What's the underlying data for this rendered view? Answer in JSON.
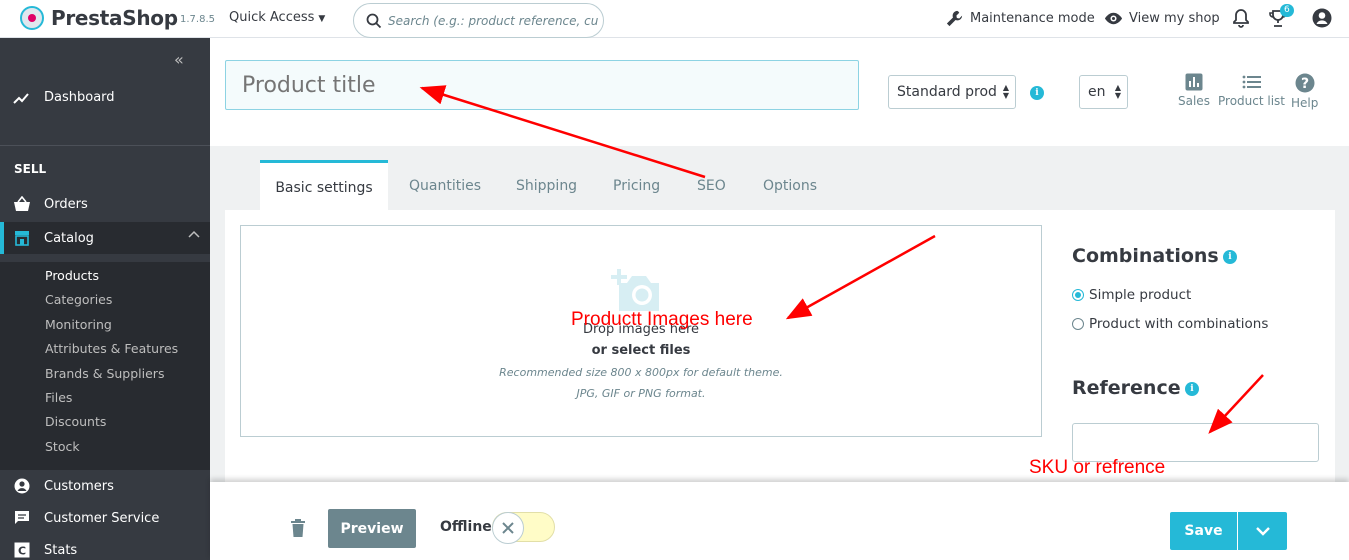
{
  "header": {
    "brand_prefix": "Presta",
    "brand_suffix": "Shop",
    "version": "1.7.8.5",
    "quick_access": "Quick Access",
    "search_placeholder": "Search (e.g.: product reference, custon",
    "maintenance": "Maintenance mode",
    "view_shop": "View my shop",
    "trophy_badge": "6"
  },
  "sidebar": {
    "dashboard": "Dashboard",
    "section_sell": "SELL",
    "orders": "Orders",
    "catalog": "Catalog",
    "catalog_sub": [
      "Products",
      "Categories",
      "Monitoring",
      "Attributes & Features",
      "Brands & Suppliers",
      "Files",
      "Discounts",
      "Stock"
    ],
    "customers": "Customers",
    "customer_service": "Customer Service",
    "stats": "Stats"
  },
  "product": {
    "title_placeholder": "Product title",
    "type_selected": "Standard prod",
    "lang_selected": "en"
  },
  "toolbar": {
    "sales": "Sales",
    "product_list": "Product list",
    "help": "Help"
  },
  "tabs": [
    "Basic settings",
    "Quantities",
    "Shipping",
    "Pricing",
    "SEO",
    "Options"
  ],
  "dropzone": {
    "drop": "Drop images here",
    "select": "or select files",
    "recommended": "Recommended size 800 x 800px for default theme.",
    "format": "JPG, GIF or PNG format."
  },
  "combinations": {
    "title": "Combinations",
    "simple": "Simple product",
    "with_combinations": "Product with combinations"
  },
  "reference": {
    "title": "Reference",
    "value": ""
  },
  "footer": {
    "preview": "Preview",
    "offline": "Offline",
    "save": "Save"
  },
  "annotations": {
    "images": "Productt Images here",
    "sku": "SKU or refrence"
  },
  "colors": {
    "accent": "#25b9d7",
    "sidebar": "#363a41",
    "annotation": "#ff0000"
  }
}
